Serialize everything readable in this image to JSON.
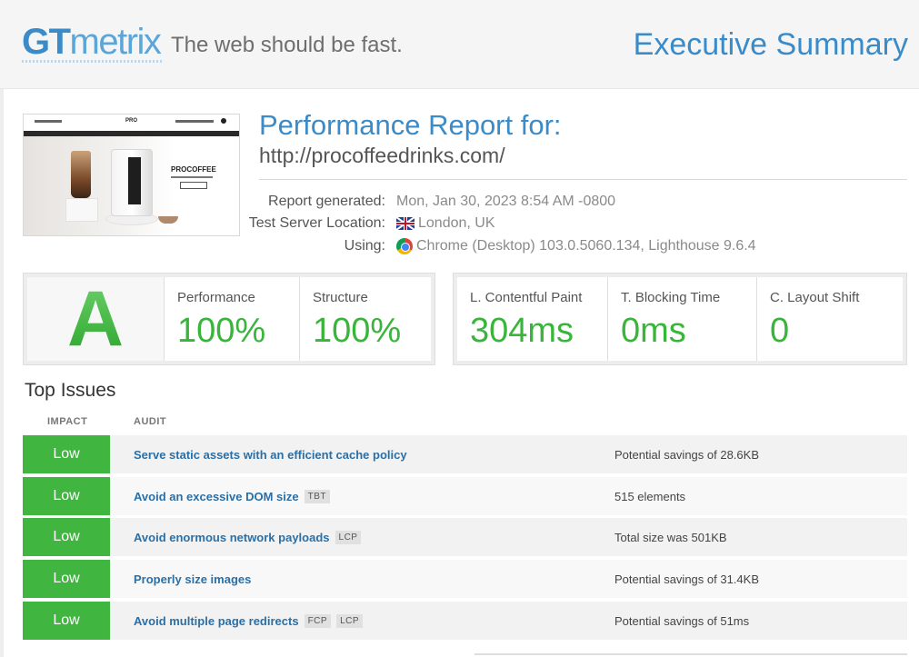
{
  "header": {
    "logo_gt": "GT",
    "logo_metrix": "metrix",
    "tagline": "The web should be fast.",
    "page_title": "Executive Summary"
  },
  "thumbnail": {
    "nav_center": "PRO",
    "brand": "PROCOFFEE"
  },
  "report": {
    "title": "Performance Report for:",
    "url": "http://procoffeedrinks.com/",
    "generated_label": "Report generated:",
    "generated_value": "Mon, Jan 30, 2023 8:54 AM -0800",
    "location_label": "Test Server Location:",
    "location_value": "London, UK",
    "using_label": "Using:",
    "using_value": "Chrome (Desktop) 103.0.5060.134, Lighthouse 9.6.4"
  },
  "grade": {
    "letter": "A",
    "performance_label": "Performance",
    "performance_value": "100%",
    "structure_label": "Structure",
    "structure_value": "100%"
  },
  "vitals": {
    "lcp_label": "L. Contentful Paint",
    "lcp_value": "304ms",
    "tbt_label": "T. Blocking Time",
    "tbt_value": "0ms",
    "cls_label": "C. Layout Shift",
    "cls_value": "0"
  },
  "issues": {
    "title": "Top Issues",
    "col_impact": "IMPACT",
    "col_audit": "AUDIT",
    "rows": [
      {
        "impact": "Low",
        "audit": "Serve static assets with an efficient cache policy",
        "tags": [],
        "detail": "Potential savings of 28.6KB"
      },
      {
        "impact": "Low",
        "audit": "Avoid an excessive DOM size",
        "tags": [
          "TBT"
        ],
        "detail": "515 elements"
      },
      {
        "impact": "Low",
        "audit": "Avoid enormous network payloads",
        "tags": [
          "LCP"
        ],
        "detail": "Total size was 501KB"
      },
      {
        "impact": "Low",
        "audit": "Properly size images",
        "tags": [],
        "detail": "Potential savings of 31.4KB"
      },
      {
        "impact": "Low",
        "audit": "Avoid multiple page redirects",
        "tags": [
          "FCP",
          "LCP"
        ],
        "detail": "Potential savings of 51ms"
      }
    ]
  },
  "colors": {
    "brand_blue": "#3a8bc8",
    "grade_green": "#38b53a",
    "impact_low": "#40b540",
    "audit_link": "#2a6fa6"
  },
  "icons": {
    "flag": "uk-flag-icon",
    "browser": "chrome-icon"
  }
}
